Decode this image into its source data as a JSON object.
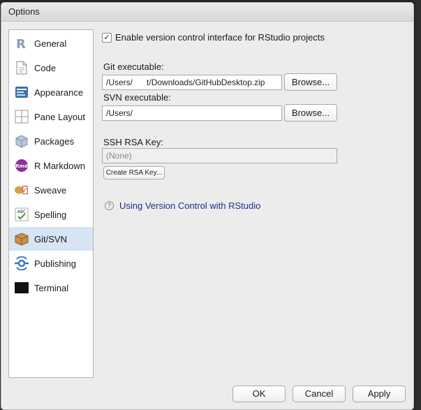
{
  "window": {
    "title": "Options"
  },
  "sidebar": {
    "items": [
      {
        "label": "General",
        "icon": "r-logo-icon"
      },
      {
        "label": "Code",
        "icon": "code-page-icon"
      },
      {
        "label": "Appearance",
        "icon": "appearance-icon"
      },
      {
        "label": "Pane Layout",
        "icon": "pane-layout-icon"
      },
      {
        "label": "Packages",
        "icon": "packages-icon"
      },
      {
        "label": "R Markdown",
        "icon": "rmarkdown-icon"
      },
      {
        "label": "Sweave",
        "icon": "sweave-icon"
      },
      {
        "label": "Spelling",
        "icon": "spelling-icon"
      },
      {
        "label": "Git/SVN",
        "icon": "git-svn-icon",
        "selected": true
      },
      {
        "label": "Publishing",
        "icon": "publishing-icon"
      },
      {
        "label": "Terminal",
        "icon": "terminal-icon"
      }
    ],
    "rmd_badge": "Rmd",
    "abc_badge": "ABC"
  },
  "git_svn": {
    "enable_vcs_label": "Enable version control interface for RStudio projects",
    "enable_vcs_checked": true,
    "git_label": "Git executable:",
    "git_value": "/Users/   t/Downloads/GitHubDesktop.zip",
    "svn_label": "SVN executable:",
    "svn_value": "/Users/",
    "browse_label": "Browse...",
    "ssh_label": "SSH RSA Key:",
    "ssh_value": "(None)",
    "create_key_label": "Create RSA Key...",
    "help_icon_glyph": "?",
    "help_link": "Using Version Control with RStudio"
  },
  "footer": {
    "ok": "OK",
    "cancel": "Cancel",
    "apply": "Apply"
  },
  "colors": {
    "selected_bg": "#d6e4f3",
    "link": "#1b2f8f",
    "rmd_badge": "#8e2d9e"
  }
}
